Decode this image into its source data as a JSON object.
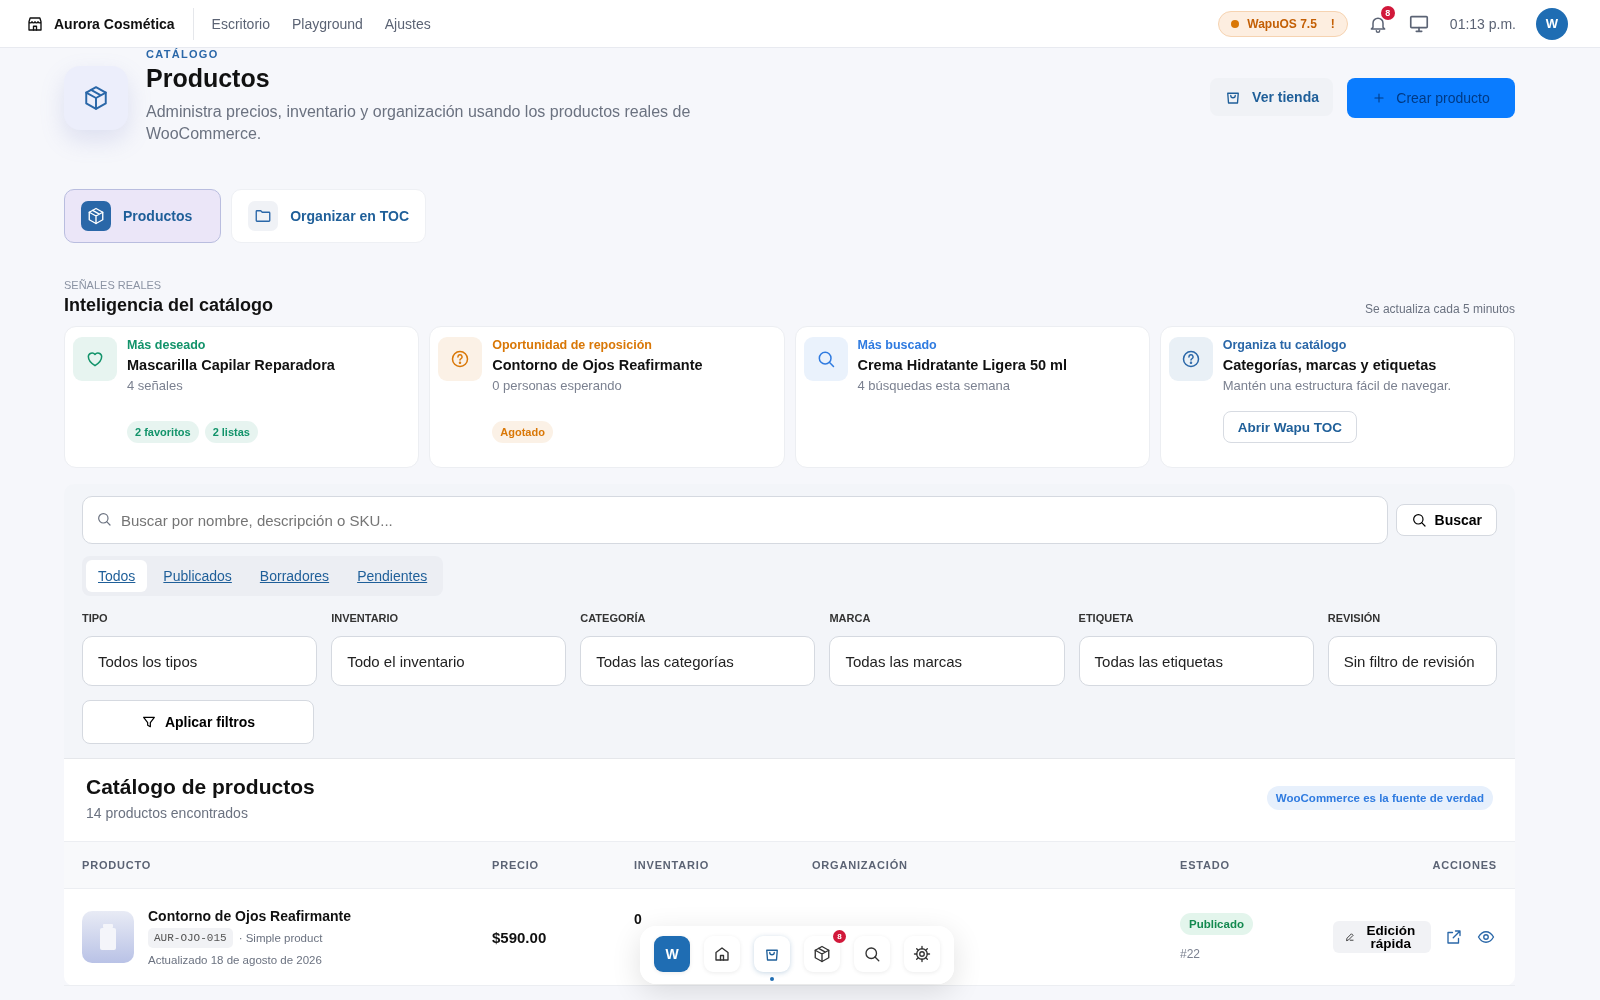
{
  "topbar": {
    "brand": "Aurora Cosmética",
    "nav": [
      {
        "label": "Escritorio",
        "selected": false
      },
      {
        "label": "Playground",
        "selected": false
      },
      {
        "label": "Ajustes",
        "selected": false
      }
    ],
    "version": {
      "label": "WapuOS 7.5",
      "alert": "!"
    },
    "notifications": "8",
    "time": "01:13 p.m.",
    "avatar": "W"
  },
  "header": {
    "eyebrow": "CATÁLOGO",
    "title": "Productos",
    "description": "Administra precios, inventario y organización usando los productos reales de WooCommerce.",
    "secondary_button": "Ver tienda",
    "primary_button": "Crear producto"
  },
  "view_tabs": [
    {
      "label": "Productos",
      "selected": true
    },
    {
      "label": "Organizar en TOC",
      "selected": false
    }
  ],
  "insights": {
    "eyebrow": "SEÑALES REALES",
    "title": "Inteligencia del catálogo",
    "note": "Se actualiza cada 5 minutos",
    "cards": [
      {
        "kind": "tags",
        "color": "#12936a",
        "label": "Más deseado",
        "title": "Mascarilla Capilar Reparadora",
        "detail": "4 señales",
        "tags": [
          "2 favoritos",
          "2 listas"
        ]
      },
      {
        "kind": "tags",
        "color": "#d97706",
        "label": "Oportunidad de reposición",
        "title": "Contorno de Ojos Reafirmante",
        "detail": "0 personas esperando",
        "tags": [
          "Agotado"
        ]
      },
      {
        "kind": "plain",
        "color": "#2f7be0",
        "label": "Más buscado",
        "title": "Crema Hidratante Ligera 50 ml",
        "detail": "4 búsquedas esta semana"
      },
      {
        "kind": "button",
        "color": "#2a67a8",
        "label": "Organiza tu catálogo",
        "title": "Categorías, marcas y etiquetas",
        "detail": "Mantén una estructura fácil de navegar.",
        "button": "Abrir Wapu TOC"
      }
    ]
  },
  "filters": {
    "search": {
      "placeholder": "Buscar por nombre, descripción o SKU...",
      "button": "Buscar"
    },
    "status_tabs": [
      {
        "label": "Todos",
        "selected": true
      },
      {
        "label": "Publicados",
        "selected": false
      },
      {
        "label": "Borradores",
        "selected": false
      },
      {
        "label": "Pendientes",
        "selected": false
      }
    ],
    "selects": [
      {
        "label": "TIPO",
        "value": "Todos los tipos"
      },
      {
        "label": "INVENTARIO",
        "value": "Todo el inventario"
      },
      {
        "label": "CATEGORÍA",
        "value": "Todas las categorías"
      },
      {
        "label": "MARCA",
        "value": "Todas las marcas"
      },
      {
        "label": "ETIQUETA",
        "value": "Todas las etiquetas"
      },
      {
        "label": "REVISIÓN",
        "value": "Sin filtro de revisión"
      }
    ],
    "apply_button": "Aplicar filtros"
  },
  "catalog": {
    "title": "Catálogo de productos",
    "count": "14 productos encontrados",
    "badge": "WooCommerce es la fuente de verdad",
    "columns": [
      "PRODUCTO",
      "PRECIO",
      "INVENTARIO",
      "ORGANIZACIÓN",
      "ESTADO",
      "ACCIONES"
    ],
    "rows": [
      {
        "name": "Contorno de Ojos Reafirmante",
        "sku": "AUR-OJO-015",
        "type": "· Simple product",
        "updated": "Actualizado 18 de agosto de 2026",
        "price": "$590.00",
        "inventory": "0",
        "status": "Publicado",
        "id": "#22",
        "edit_button": "Edición rápida"
      }
    ]
  },
  "dock": {
    "logo": "W",
    "items": [
      {
        "selected": false
      },
      {
        "selected": true
      },
      {
        "selected": false,
        "badge": "8"
      },
      {
        "selected": false
      },
      {
        "selected": false
      }
    ]
  }
}
